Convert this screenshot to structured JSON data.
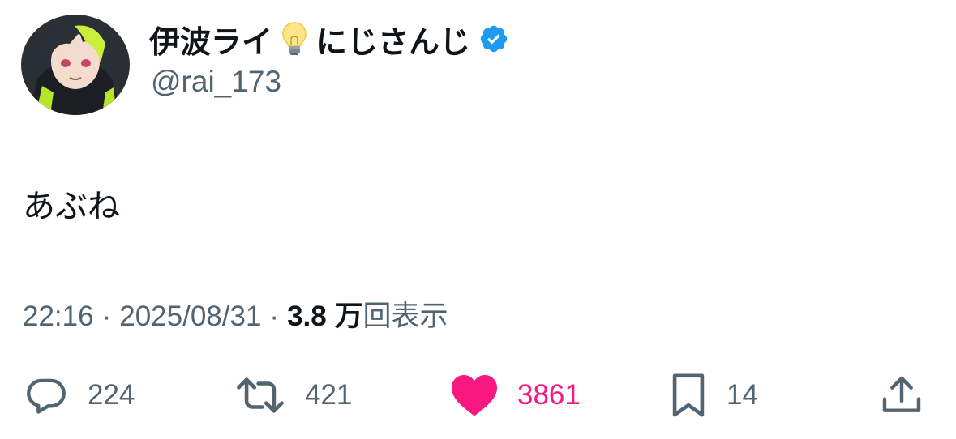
{
  "user": {
    "display_name": "伊波ライ",
    "display_name_suffix": "にじさんじ",
    "handle": "@rai_173",
    "verified": true
  },
  "tweet": {
    "text": "あぶね"
  },
  "meta": {
    "time": "22:16",
    "separator": "·",
    "date": "2025/08/31",
    "views_count": "3.8 万",
    "views_label": "回表示"
  },
  "actions": {
    "reply_count": "224",
    "retweet_count": "421",
    "like_count": "3861",
    "bookmark_count": "14"
  },
  "colors": {
    "like": "#f91880",
    "verified": "#1d9bf0",
    "secondary_text": "#536471",
    "primary_text": "#0f1419"
  },
  "icons": [
    "lightbulb-icon",
    "verified-icon",
    "reply-icon",
    "retweet-icon",
    "heart-icon",
    "bookmark-icon",
    "share-icon"
  ]
}
